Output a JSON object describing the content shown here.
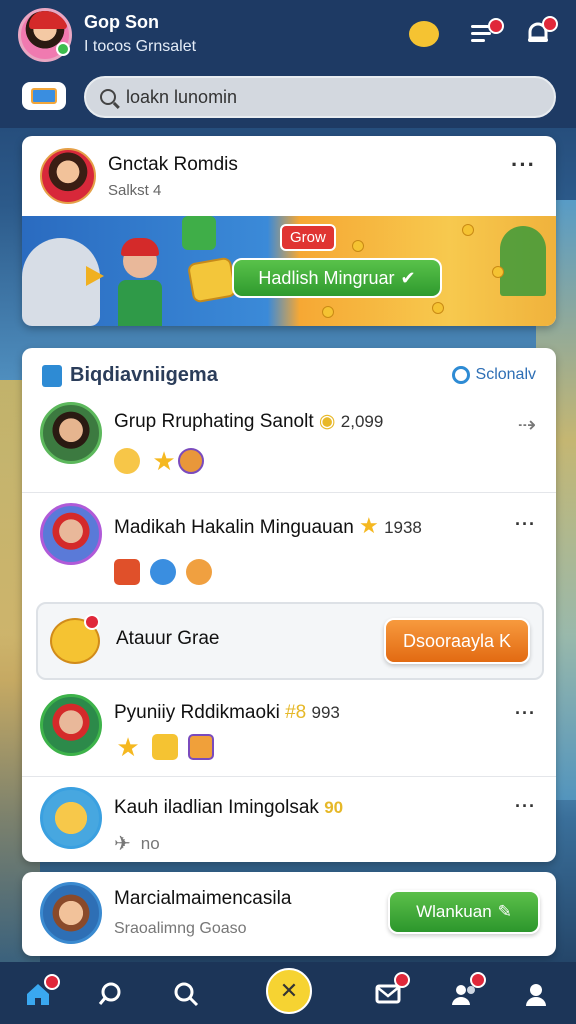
{
  "header": {
    "user_name": "Gop Son",
    "user_subtitle": "I tocos Grnsalet",
    "search_placeholder": "loakn lunomin"
  },
  "post": {
    "title": "Gnctak Romdis",
    "subtitle": "Salkst 4",
    "banner_tag": "Grow",
    "banner_button": "Hadlish Mingruar"
  },
  "panel": {
    "title": "Biqdiavniigema",
    "link": "Sclonalv",
    "rows": [
      {
        "title": "Grup Rruphating Sanolt",
        "number": "2,099"
      },
      {
        "title": "Madikah Hakalin Minguauan",
        "number": "1938"
      },
      {
        "title": "Pyuniiy Rddikmaoki",
        "number": "993",
        "prefix": "#8"
      },
      {
        "title": "Kauh iladlian Imingolsak",
        "number": "90",
        "sub": "no"
      }
    ],
    "notice": {
      "text": "Atauur Grae",
      "button": "Dsooraayla K"
    }
  },
  "bottom_card": {
    "title": "Marcialmaimencasila",
    "subtitle": "Sraoalimng Goaso",
    "button": "Wlankuan"
  },
  "colors": {
    "header_bg": "#1e3a64",
    "accent_green": "#3aa53a",
    "accent_orange": "#ee7a22",
    "badge_red": "#e0283a"
  }
}
